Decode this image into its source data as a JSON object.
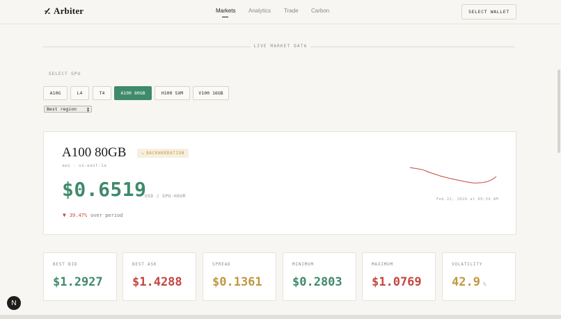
{
  "header": {
    "brand": "Arbiter",
    "nav": [
      {
        "label": "Markets",
        "active": true
      },
      {
        "label": "Analytics",
        "active": false
      },
      {
        "label": "Trade",
        "active": false
      },
      {
        "label": "Carbon",
        "active": false
      }
    ],
    "wallet_button": "SELECT WALLET"
  },
  "section": {
    "divider_label": "LIVE MARKET DATA"
  },
  "selector": {
    "label": "SELECT GPU",
    "gpus": [
      "A10G",
      "L4",
      "T4",
      "A100 80GB",
      "H100 SXM",
      "V100 16GB"
    ],
    "active_gpu": "A100 80GB",
    "region_value": "Best region"
  },
  "summary": {
    "title": "A100 80GB",
    "badge": "BACKWARDATION",
    "badge_icon": "trend-down-arrow",
    "region": "aws · us-east-1a",
    "price": "$0.6519",
    "price_unit": "USD / GPU-HOUR",
    "change": "39.47%",
    "change_direction": "down",
    "change_label": "over period",
    "timestamp": "Feb 22, 2026 at 09:34 AM"
  },
  "stats": [
    {
      "label": "BEST BID",
      "value": "$1.2927",
      "unit": "",
      "color": "#3f8a6b"
    },
    {
      "label": "BEST ASK",
      "value": "$1.4288",
      "unit": "",
      "color": "#c4463f"
    },
    {
      "label": "SPREAD",
      "value": "$0.1361",
      "unit": "",
      "color": "#bf9840"
    },
    {
      "label": "MINIMUM",
      "value": "$0.2803",
      "unit": "",
      "color": "#3f8a6b"
    },
    {
      "label": "MAXIMUM",
      "value": "$1.0769",
      "unit": "",
      "color": "#c4463f"
    },
    {
      "label": "VOLATILITY",
      "value": "42.9",
      "unit": "%",
      "color": "#bf9840"
    }
  ],
  "colors": {
    "accent_green": "#3f8a6b",
    "down_red": "#c4463f",
    "gold": "#bf9840",
    "background": "#f7f6f2"
  },
  "footer_badge": "N"
}
